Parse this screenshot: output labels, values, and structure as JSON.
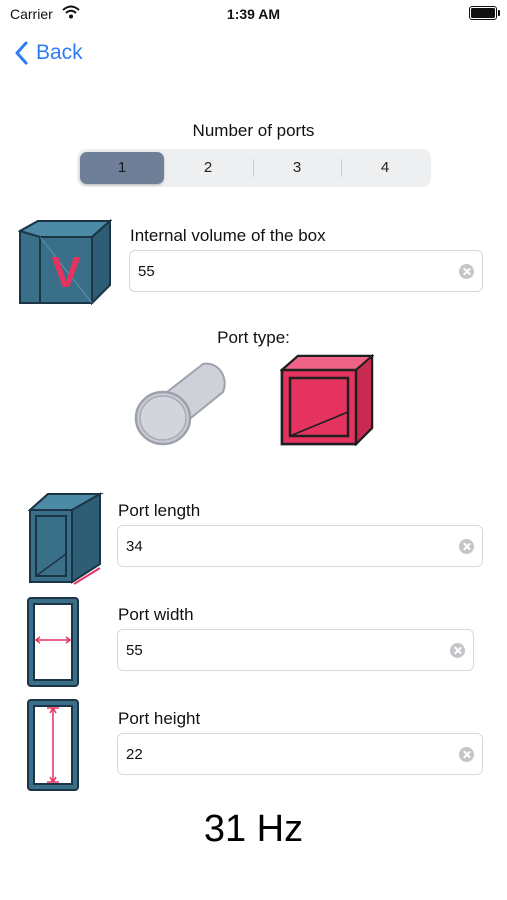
{
  "status": {
    "carrier": "Carrier",
    "time": "1:39 AM"
  },
  "nav": {
    "back_label": "Back"
  },
  "ports": {
    "title": "Number of ports",
    "options": [
      "1",
      "2",
      "3",
      "4"
    ],
    "selected": "1"
  },
  "volume": {
    "label": "Internal volume of the box",
    "value": "55",
    "icon_letter": "V"
  },
  "port_type": {
    "label": "Port type:"
  },
  "port_length": {
    "label": "Port length",
    "value": "34"
  },
  "port_width": {
    "label": "Port width",
    "value": "55"
  },
  "port_height": {
    "label": "Port height",
    "value": "22"
  },
  "result": {
    "text": "31 Hz"
  },
  "colors": {
    "accent": "#2f7cf6",
    "box_teal": "#3a6f8a",
    "port_pink": "#e3335e",
    "segment_selected": "#6f7f98"
  }
}
